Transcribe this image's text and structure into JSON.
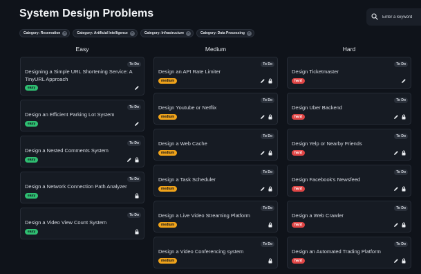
{
  "header": {
    "title": "System Design Problems"
  },
  "search": {
    "placeholder": "Enter a keyword"
  },
  "filters": [
    {
      "label": "Category: Reservation"
    },
    {
      "label": "Category: Artificial Intelligence"
    },
    {
      "label": "Category: Infrastructure"
    },
    {
      "label": "Category: Data Processing"
    }
  ],
  "columns": [
    {
      "label": "Easy",
      "cards": [
        {
          "title": "Designing a Simple URL Shortening Service: A TinyURL Approach",
          "status": "To Do",
          "difficulty": "easy",
          "edit": true,
          "lock": false
        },
        {
          "title": "Design an Efficient Parking Lot System",
          "status": "To Do",
          "difficulty": "easy",
          "edit": true,
          "lock": false
        },
        {
          "title": "Design a Nested Comments System",
          "status": "To Do",
          "difficulty": "easy",
          "edit": true,
          "lock": true
        },
        {
          "title": "Design a Network Connection Path Analyzer",
          "status": "To Do",
          "difficulty": "easy",
          "edit": false,
          "lock": true
        },
        {
          "title": "Design a Video View Count System",
          "status": "To Do",
          "difficulty": "easy",
          "edit": false,
          "lock": true
        }
      ]
    },
    {
      "label": "Medium",
      "cards": [
        {
          "title": "Design an API Rate Limiter",
          "status": "To Do",
          "difficulty": "medium",
          "edit": true,
          "lock": true
        },
        {
          "title": "Design Youtube or Netflix",
          "status": "To Do",
          "difficulty": "medium",
          "edit": true,
          "lock": true
        },
        {
          "title": "Design a Web Cache",
          "status": "To Do",
          "difficulty": "medium",
          "edit": true,
          "lock": true
        },
        {
          "title": "Design a Task Scheduler",
          "status": "To Do",
          "difficulty": "medium",
          "edit": true,
          "lock": true
        },
        {
          "title": "Design a Live Video Streaming Platform",
          "status": "To Do",
          "difficulty": "medium",
          "edit": false,
          "lock": true
        },
        {
          "title": "Design a Video Conferencing system",
          "status": "To Do",
          "difficulty": "medium",
          "edit": false,
          "lock": true
        }
      ]
    },
    {
      "label": "Hard",
      "cards": [
        {
          "title": "Design Ticketmaster",
          "status": "To Do",
          "difficulty": "hard",
          "edit": true,
          "lock": false
        },
        {
          "title": "Design Uber Backend",
          "status": "To Do",
          "difficulty": "hard",
          "edit": true,
          "lock": true
        },
        {
          "title": "Design Yelp or Nearby Friends",
          "status": "To Do",
          "difficulty": "hard",
          "edit": true,
          "lock": true
        },
        {
          "title": "Design Facebook's Newsfeed",
          "status": "To Do",
          "difficulty": "hard",
          "edit": true,
          "lock": true
        },
        {
          "title": "Design a Web Crawler",
          "status": "To Do",
          "difficulty": "hard",
          "edit": true,
          "lock": true
        },
        {
          "title": "Design an Automated Trading Platform",
          "status": "To Do",
          "difficulty": "hard",
          "edit": true,
          "lock": true
        }
      ]
    }
  ]
}
